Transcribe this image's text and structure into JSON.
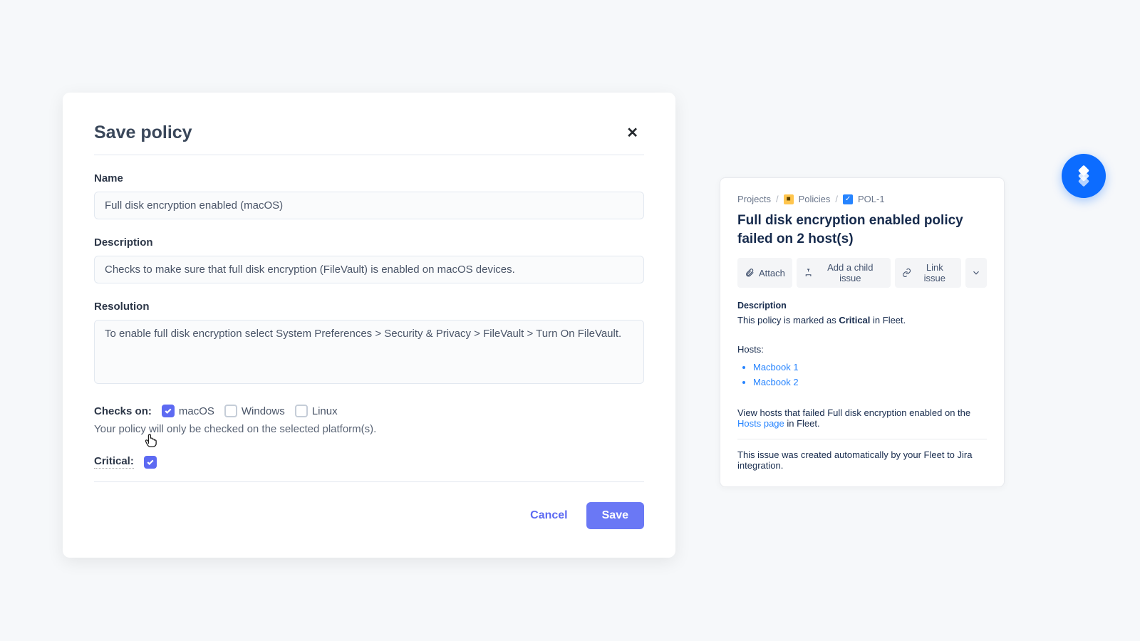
{
  "modal": {
    "title": "Save policy",
    "close_symbol": "✕",
    "name_label": "Name",
    "name_value": "Full disk encryption enabled (macOS)",
    "description_label": "Description",
    "description_value": "Checks to make sure that full disk encryption (FileVault) is enabled on macOS devices.",
    "resolution_label": "Resolution",
    "resolution_value": "To enable full disk encryption select System Preferences > Security & Privacy > FileVault > Turn On FileVault.",
    "checks_label": "Checks on:",
    "platforms": {
      "macos": "macOS",
      "windows": "Windows",
      "linux": "Linux"
    },
    "help_text": "Your policy will only be checked on the selected platform(s).",
    "critical_label": "Critical:",
    "cancel": "Cancel",
    "save": "Save"
  },
  "jira": {
    "breadcrumb": {
      "projects": "Projects",
      "policies": "Policies",
      "issue": "POL-1"
    },
    "title": "Full disk encryption enabled policy failed on 2 host(s)",
    "actions": {
      "attach": "Attach",
      "add_child": "Add a child issue",
      "link": "Link issue"
    },
    "desc_label": "Description",
    "desc_pre": "This policy is marked as ",
    "desc_strong": "Critical",
    "desc_post": " in Fleet.",
    "hosts_label": "Hosts:",
    "hosts": [
      "Macbook 1",
      "Macbook 2"
    ],
    "view_pre": "View hosts that failed Full disk encryption enabled on the ",
    "view_link": "Hosts page",
    "view_post": " in Fleet.",
    "created": "This issue was created automatically by your Fleet to Jira integration."
  }
}
